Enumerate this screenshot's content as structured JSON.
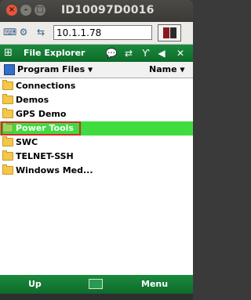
{
  "window": {
    "title": "ID10097D0016",
    "close_glyph": "×",
    "min_glyph": "–",
    "max_glyph": "□"
  },
  "toolbar": {
    "ip_value": "10.1.1.78"
  },
  "app": {
    "title": "File Explorer",
    "status_icons": [
      "chat-icon",
      "sync-icon",
      "signal-off-icon",
      "volume-icon",
      "close-icon"
    ],
    "status_glyphs": [
      "💬",
      "⇄",
      "Ƴ",
      "◀",
      "✕"
    ]
  },
  "path": {
    "folder": "Program Files",
    "sort": "Name"
  },
  "items": [
    {
      "name": "Connections"
    },
    {
      "name": "Demos"
    },
    {
      "name": "GPS Demo"
    },
    {
      "name": "Power Tools",
      "selected": true
    },
    {
      "name": "SWC"
    },
    {
      "name": "TELNET-SSH"
    },
    {
      "name": "Windows Med..."
    }
  ],
  "softkeys": {
    "left": "Up",
    "right": "Menu"
  },
  "colors": {
    "accent_green": "#1b8a3e",
    "selection_green": "#3fdc3f",
    "highlight_red": "#d32a2a"
  }
}
